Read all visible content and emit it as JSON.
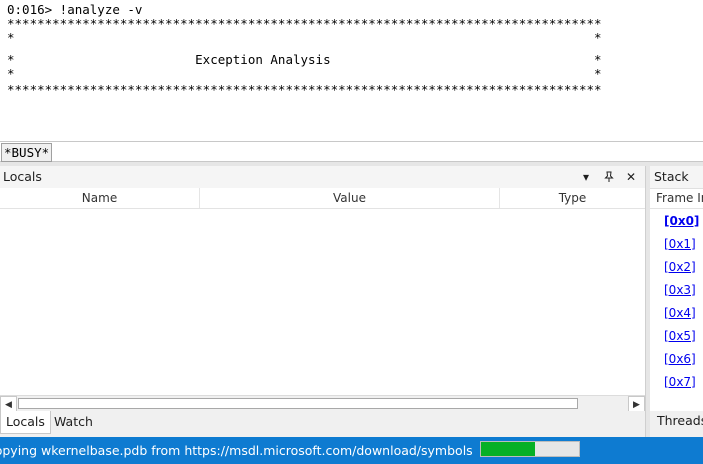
{
  "command_output": {
    "lines": [
      "0:016> !analyze -v",
      "*******************************************************************************",
      "*                                                                             *",
      "*                        Exception Analysis                                   *",
      "*                                                                             *",
      "*******************************************************************************"
    ]
  },
  "command_input": {
    "busy_label": "*BUSY*",
    "value": ""
  },
  "locals": {
    "title": "Locals",
    "columns": [
      "Name",
      "Value",
      "Type"
    ],
    "tabs": [
      "Locals",
      "Watch"
    ],
    "active_tab": "Locals",
    "dropdown_icon": "chevron-down-icon",
    "pin_icon": "pin-icon",
    "close_icon": "close-icon"
  },
  "stack": {
    "title": "Stack",
    "column_header": "Frame In",
    "frames": [
      "[0x0]",
      "[0x1]",
      "[0x2]",
      "[0x3]",
      "[0x4]",
      "[0x5]",
      "[0x6]",
      "[0x7]"
    ],
    "current_frame": "[0x0]",
    "tab": "Threads"
  },
  "status": {
    "text": "Copying wkernelbase.pdb from https://msdl.microsoft.com/download/symbols",
    "progress_fraction": 0.55,
    "bar_color": "#06b025",
    "status_bg": "#0e7bd1"
  }
}
